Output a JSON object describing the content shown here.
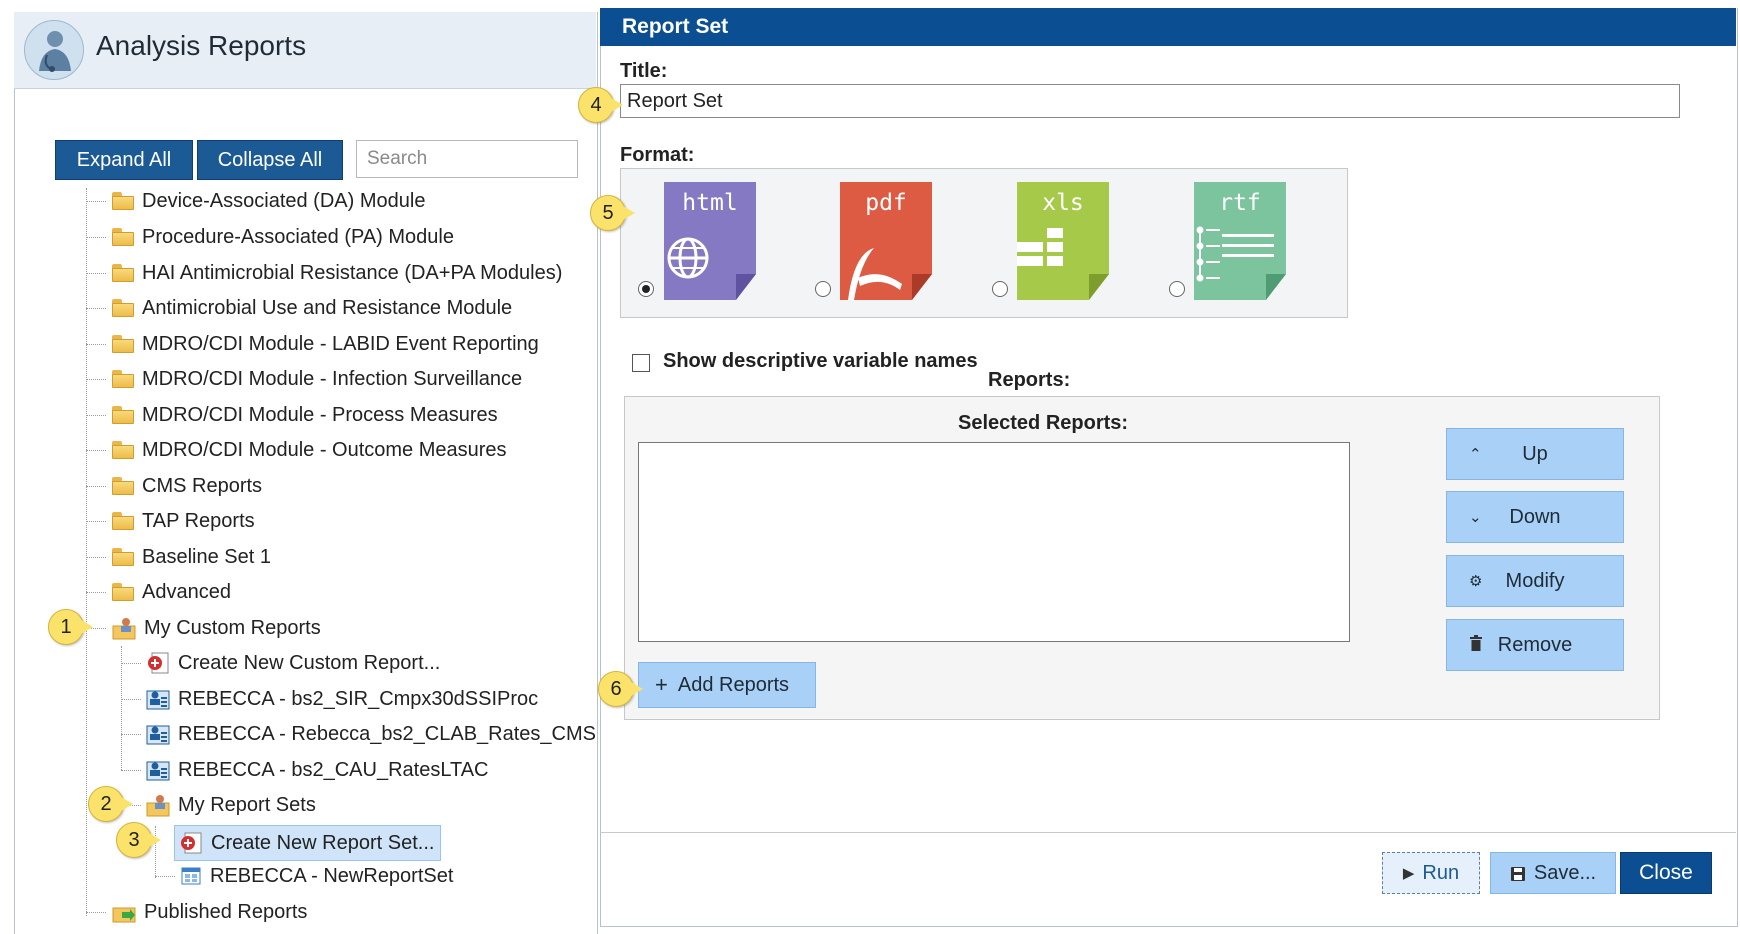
{
  "left": {
    "app_title": "Analysis Reports",
    "expand_label": "Expand All",
    "collapse_label": "Collapse All",
    "search_placeholder": "Search",
    "tree": [
      "Device-Associated (DA) Module",
      "Procedure-Associated (PA) Module",
      "HAI Antimicrobial Resistance (DA+PA Modules)",
      "Antimicrobial Use and Resistance Module",
      "MDRO/CDI Module - LABID Event Reporting",
      "MDRO/CDI Module - Infection Surveillance",
      "MDRO/CDI Module - Process Measures",
      "MDRO/CDI Module - Outcome Measures",
      "CMS Reports",
      "TAP Reports",
      "Baseline Set 1",
      "Advanced",
      "My Custom Reports",
      "Create New Custom Report...",
      "REBECCA - bs2_SIR_Cmpx30dSSIProc",
      "REBECCA - Rebecca_bs2_CLAB_Rates_CMS",
      "REBECCA - bs2_CAU_RatesLTAC",
      "My Report Sets",
      "Create New Report Set...",
      "REBECCA - NewReportSet",
      "Published Reports"
    ]
  },
  "callouts": [
    "1",
    "2",
    "3",
    "4",
    "5",
    "6"
  ],
  "right": {
    "header": "Report Set",
    "title_label": "Title:",
    "title_value": "Report Set",
    "format_label": "Format:",
    "formats": [
      "html",
      "pdf",
      "xls",
      "rtf"
    ],
    "selected_format": "html",
    "show_descriptive_label": "Show descriptive variable names",
    "reports_label": "Reports:",
    "selected_reports_label": "Selected Reports:",
    "up_label": "Up",
    "down_label": "Down",
    "modify_label": "Modify",
    "remove_label": "Remove",
    "add_reports_label": "Add Reports",
    "run_label": "Run",
    "save_label": "Save...",
    "close_label": "Close"
  },
  "colors": {
    "header_blue": "#0b4f92",
    "button_blue": "#1c5a96",
    "button_light": "#a9d1f7",
    "callout_yellow": "#fbe36b",
    "html_icon": "#8679c4",
    "pdf_icon": "#dd5a43",
    "xls_icon": "#a6c94a",
    "rtf_icon": "#7cc49d"
  }
}
